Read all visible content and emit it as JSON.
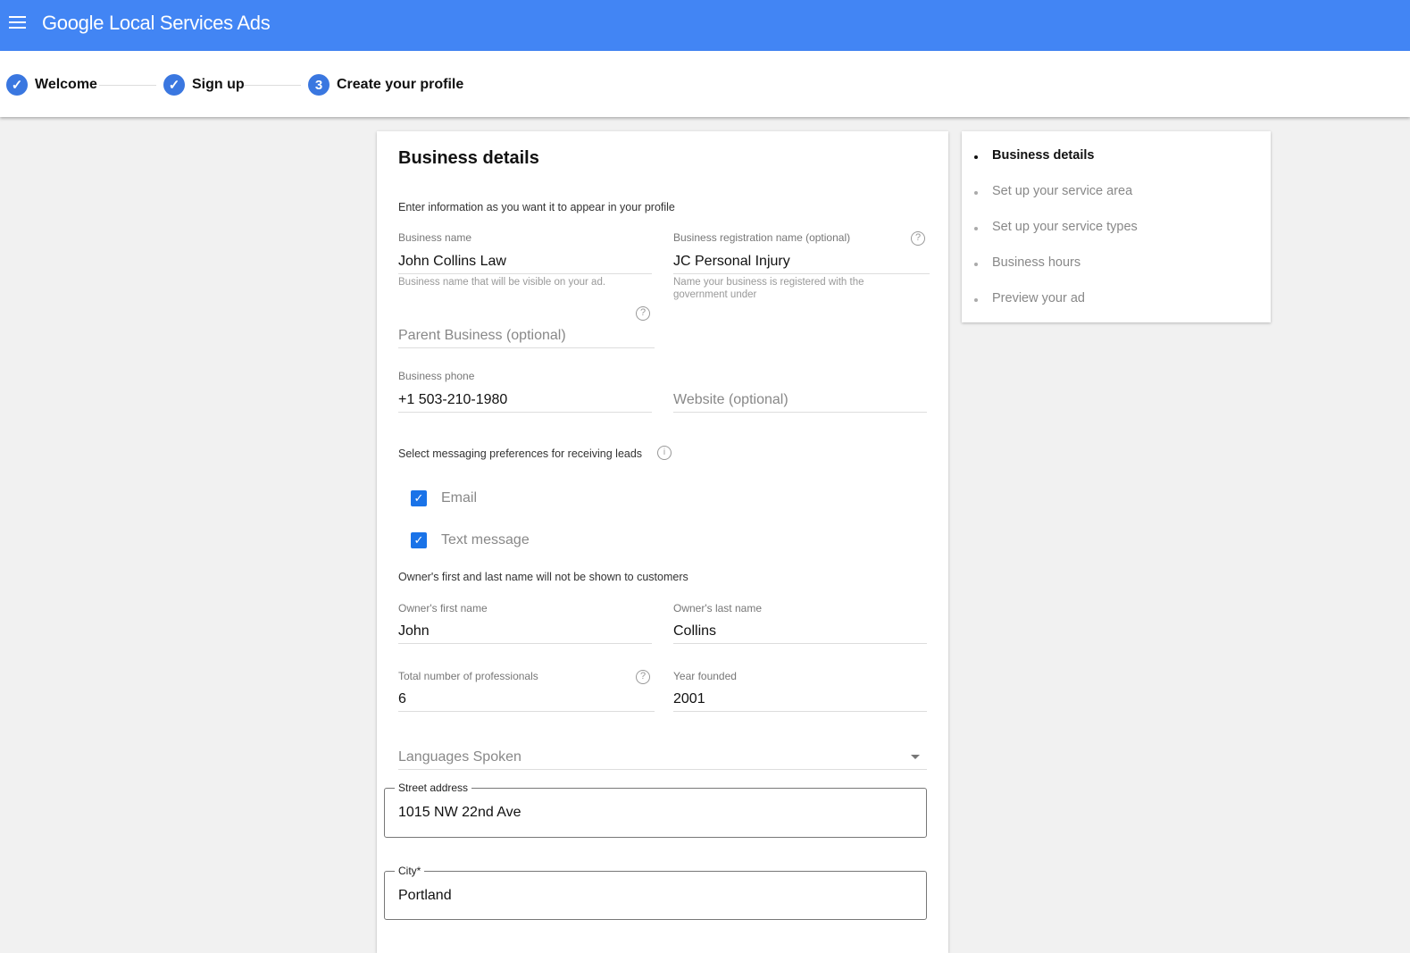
{
  "header": {
    "title": "Google Local Services Ads"
  },
  "steps": [
    {
      "label": "Welcome",
      "status": "done"
    },
    {
      "label": "Sign up",
      "status": "done"
    },
    {
      "label": "Create your profile",
      "number": "3",
      "status": "current"
    }
  ],
  "form": {
    "title": "Business details",
    "intro": "Enter information as you want it to appear in your profile",
    "business_name": {
      "label": "Business name",
      "value": "John Collins Law",
      "hint": "Business name that will be visible on your ad."
    },
    "registration_name": {
      "label": "Business registration name (optional)",
      "value": "JC Personal Injury",
      "hint": "Name your business is registered with the government under"
    },
    "parent_business": {
      "placeholder": "Parent Business (optional)"
    },
    "phone": {
      "label": "Business phone",
      "value": "+1 503-210-1980"
    },
    "website": {
      "placeholder": "Website (optional)"
    },
    "messaging": {
      "label": "Select messaging preferences for receiving leads",
      "options": [
        {
          "label": "Email",
          "checked": true
        },
        {
          "label": "Text message",
          "checked": true
        }
      ]
    },
    "owner_note": "Owner's first and last name will not be shown to customers",
    "first_name": {
      "label": "Owner's first name",
      "value": "John"
    },
    "last_name": {
      "label": "Owner's last name",
      "value": "Collins"
    },
    "professionals": {
      "label": "Total number of professionals",
      "value": "6"
    },
    "year": {
      "label": "Year founded",
      "value": "2001"
    },
    "languages": {
      "placeholder": "Languages Spoken"
    },
    "street": {
      "label": "Street address",
      "value": "1015 NW 22nd Ave"
    },
    "city": {
      "label": "City*",
      "value": "Portland"
    }
  },
  "sidenav": [
    "Business details",
    "Set up your service area",
    "Set up your service types",
    "Business hours",
    "Preview your ad"
  ],
  "colors": {
    "header": "#4285f4",
    "accent": "#1a73e8"
  }
}
